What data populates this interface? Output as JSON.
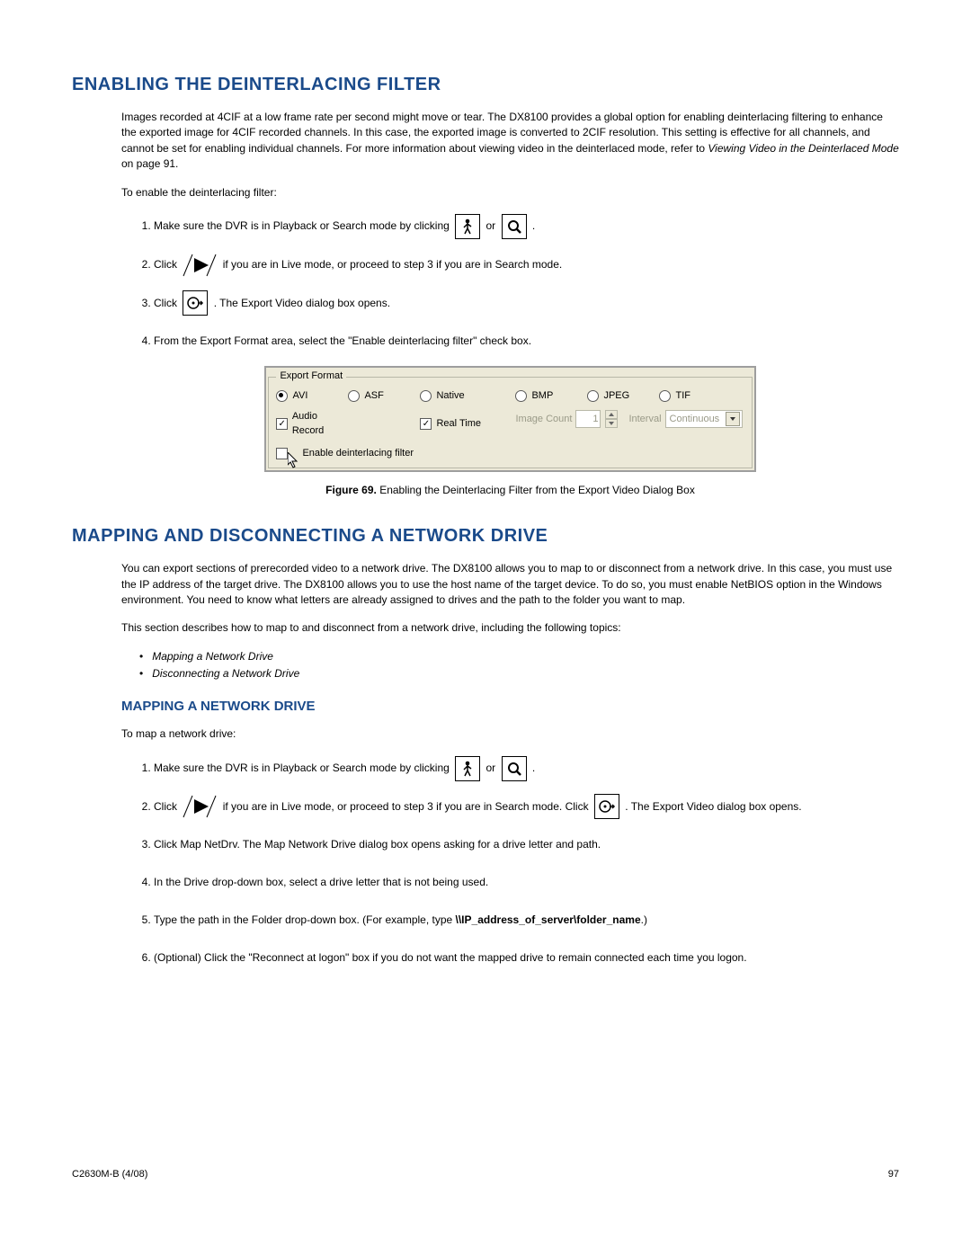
{
  "sections": {
    "deint_title": "ENABLING THE DEINTERLACING FILTER",
    "deint_intro_a": "Images recorded at 4CIF at a low frame rate per second might move or tear. The DX8100 provides a global option for enabling deinterlacing filtering to enhance the exported image for 4CIF recorded channels. In this case, the exported image is converted to 2CIF resolution. This setting is effective for all channels, and cannot be set for enabling individual channels. For more information about viewing video in the deinterlaced mode, refer to ",
    "deint_intro_ref": "Viewing Video in the Deinterlaced Mode",
    "deint_intro_b": " on page 91.",
    "deint_lead": "To enable the deinterlacing filter:",
    "deint_step1_a": "Make sure the DVR is in Playback or Search mode by clicking ",
    "deint_step1_or": " or ",
    "deint_step1_b": " .",
    "deint_step2_a": "Click ",
    "deint_step2_b": " if you are in Live mode, or proceed to step 3 if you are in Search mode.",
    "deint_step3_a": "Click ",
    "deint_step3_b": ". The Export Video dialog box opens.",
    "deint_step4": "From the Export Format area, select the \"Enable deinterlacing filter\" check box.",
    "fig_label": "Figure 69.",
    "fig_caption": "  Enabling the Deinterlacing Filter from the Export Video Dialog Box",
    "map_title": "MAPPING AND DISCONNECTING A NETWORK DRIVE",
    "map_intro": "You can export sections of prerecorded video to a network drive. The DX8100 allows you to map to or disconnect from a network drive. In this case, you must use the IP address of the target drive. The DX8100 allows you to use the host name of the target device. To do so, you must enable NetBIOS option in the Windows environment. You need to know what letters are already assigned to drives and the path to the folder you want to map.",
    "map_sub": "This section describes how to map to and disconnect from a network drive, including the following topics:",
    "map_topic1": "Mapping a Network Drive",
    "map_topic2": "Disconnecting a Network Drive",
    "map_drive_title": "MAPPING A NETWORK DRIVE",
    "map_lead": "To map a network drive:",
    "map_step1_a": "Make sure the DVR is in Playback or Search mode by clicking ",
    "map_step1_or": " or ",
    "map_step1_b": " .",
    "map_step2_a": "Click ",
    "map_step2_b": " if you are in Live mode, or proceed to step 3 if you are in Search mode. Click ",
    "map_step2_c": ". The Export Video dialog box opens.",
    "map_step3": "Click Map NetDrv. The Map Network Drive dialog box opens asking for a drive letter and path.",
    "map_step4": "In the Drive drop-down box, select a drive letter that is not being used.",
    "map_step5_a": "Type the path in the Folder drop-down box. (For example, type ",
    "map_step5_b": "\\\\IP_address_of_server\\folder_name",
    "map_step5_c": ".)",
    "map_step6": "(Optional) Click the \"Reconnect at logon\" box if you do not want the mapped drive to remain connected each time you logon."
  },
  "export_format": {
    "legend": "Export Format",
    "avi": "AVI",
    "asf": "ASF",
    "native": "Native",
    "audio": "Audio Record",
    "realtime": "Real Time",
    "bmp": "BMP",
    "jpeg": "JPEG",
    "tif": "TIF",
    "image_count_label": "Image Count",
    "image_count_value": "1",
    "interval_label": "Interval",
    "interval_value": "Continuous",
    "deint_label": "Enable deinterlacing filter"
  },
  "footer": {
    "left": "C2630M-B (4/08)",
    "right": "97"
  }
}
